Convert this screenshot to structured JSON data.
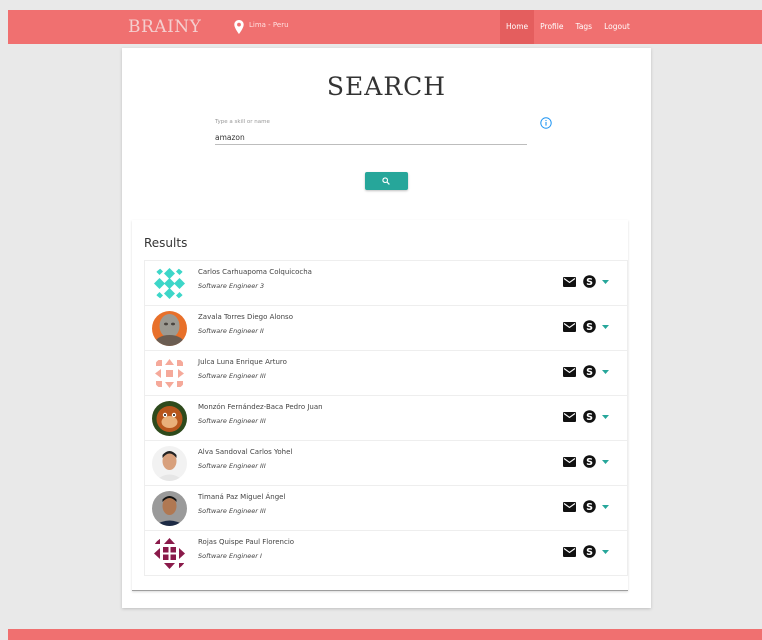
{
  "header": {
    "brand": "BRAINY",
    "location": "Lima - Peru",
    "nav": [
      "Home",
      "Profile",
      "Tags",
      "Logout"
    ]
  },
  "search": {
    "title": "SEARCH",
    "label": "Type a skill or name",
    "value": "amazon"
  },
  "results": {
    "title": "Results",
    "items": [
      {
        "name": "Carlos Carhuapoma Colquicocha",
        "role": "Software Engineer 3"
      },
      {
        "name": "Zavala Torres Diego Alonso",
        "role": "Software Engineer II"
      },
      {
        "name": "Julca Luna Enrique Arturo",
        "role": "Software Engineer III"
      },
      {
        "name": "Monzón Fernández-Baca Pedro Juan",
        "role": "Software Engineer III"
      },
      {
        "name": "Alva Sandoval Carlos Yohel",
        "role": "Software Engineer III"
      },
      {
        "name": "Timaná Paz Miguel Ángel",
        "role": "Software Engineer III"
      },
      {
        "name": "Rojas Quispe Paul Florencio",
        "role": "Software Engineer I"
      }
    ]
  },
  "colors": {
    "header": "#f07070",
    "header_active": "#e45e5e",
    "accent": "#26a69a",
    "info": "#2196f3"
  },
  "icons": [
    "location-pin-icon",
    "info-icon",
    "search-icon",
    "mail-icon",
    "skype-icon",
    "caret-down-icon"
  ]
}
